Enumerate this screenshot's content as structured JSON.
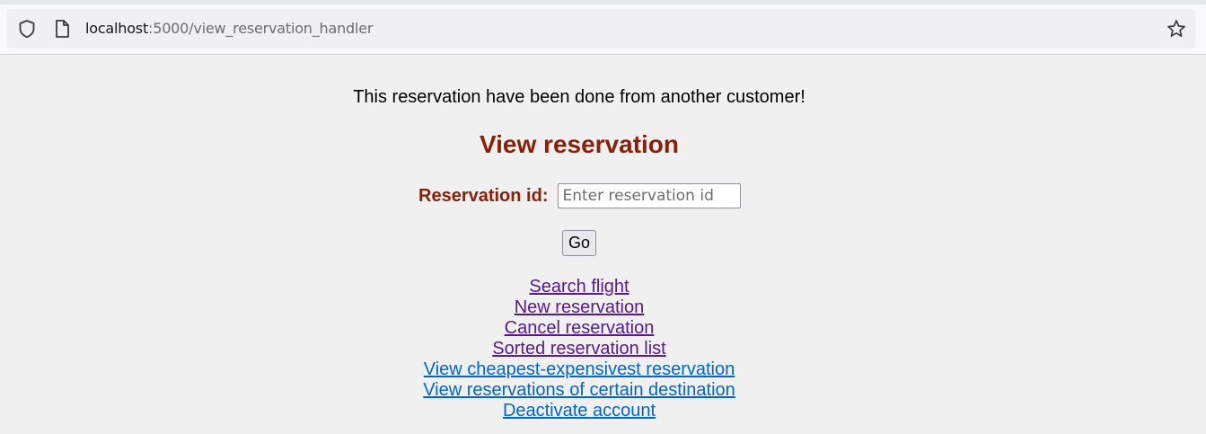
{
  "browser": {
    "url_host": "localhost",
    "url_rest": ":5000/view_reservation_handler",
    "icons": [
      "shield-icon",
      "page-icon",
      "bookmark-star-icon"
    ]
  },
  "page": {
    "message": "This reservation have been done from another customer!",
    "title": "View reservation",
    "form": {
      "label": "Reservation id:",
      "placeholder": "Enter reservation id",
      "value": "",
      "submit_label": "Go"
    },
    "links": [
      {
        "label": "Search flight",
        "visited": true
      },
      {
        "label": "New reservation",
        "visited": true
      },
      {
        "label": "Cancel reservation",
        "visited": true
      },
      {
        "label": "Sorted reservation list",
        "visited": true
      },
      {
        "label": "View cheapest-expensivest reservation",
        "visited": false
      },
      {
        "label": "View reservations of certain destination",
        "visited": false
      },
      {
        "label": "Deactivate account",
        "visited": false
      }
    ]
  },
  "colors": {
    "heading": "#8b2008",
    "visited_link": "#551a8b",
    "link": "#0066cc",
    "background": "#f0f0f0"
  }
}
